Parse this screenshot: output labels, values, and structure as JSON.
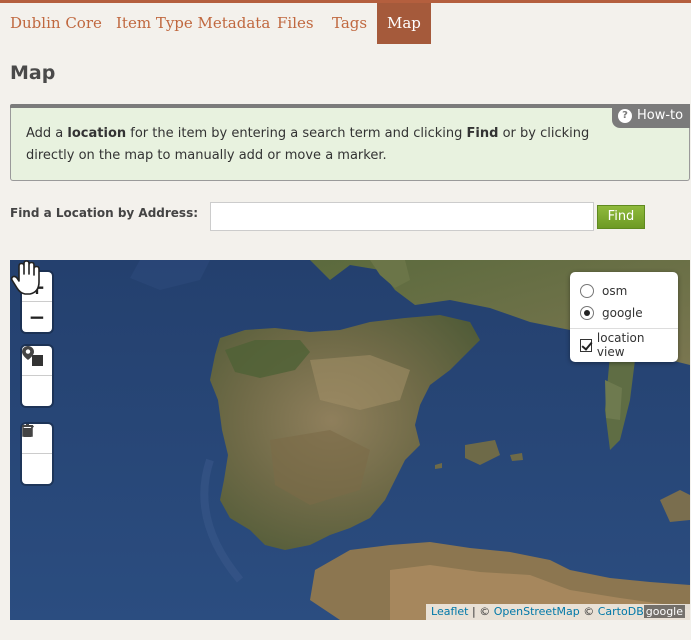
{
  "tabs": [
    {
      "label": "Dublin Core"
    },
    {
      "label": "Item Type Metadata"
    },
    {
      "label": "Files"
    },
    {
      "label": "Tags"
    },
    {
      "label": "Map",
      "active": true
    }
  ],
  "page_title": "Map",
  "info": {
    "howto_label": "How-to",
    "text_1": "Add a ",
    "bold_1": "location",
    "text_2": " for the item by entering a search term and clicking ",
    "bold_2": "Find",
    "text_3": " or by clicking directly on the map to manually add or move a marker."
  },
  "find": {
    "label": "Find a Location by Address:",
    "input_value": "",
    "button_label": "Find"
  },
  "map": {
    "zoom_in": "+",
    "zoom_out": "−",
    "layers": [
      {
        "label": "osm",
        "selected": false
      },
      {
        "label": "google",
        "selected": true
      }
    ],
    "location_view_label": "location view",
    "location_view_checked": true,
    "attribution": {
      "leaflet": "Leaflet",
      "sep": " | © ",
      "osm": "OpenStreetMap",
      "copy": " © ",
      "carto": "CartoDB",
      "google": "google"
    }
  },
  "colors": {
    "accent": "#a55a3b",
    "tab_text": "#c0683f",
    "info_bg": "#e8f2df",
    "find_button": "#7aa72c",
    "sea": "#2e4a78"
  }
}
